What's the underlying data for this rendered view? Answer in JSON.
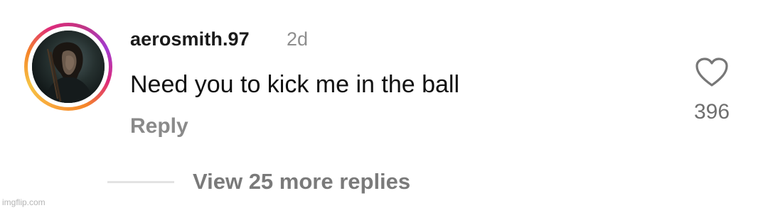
{
  "comment": {
    "username": "aerosmith.97",
    "timestamp": "2d",
    "text": "Need you to kick me in the ball",
    "reply_label": "Reply",
    "like_count": "396",
    "like_icon": "heart-outline-icon",
    "avatar_ring_colors": [
      "#f58529",
      "#dd2a7b",
      "#c13584",
      "#f9a33a"
    ]
  },
  "replies": {
    "view_more_label": "View 25 more replies"
  },
  "watermark": "imgflip.com"
}
